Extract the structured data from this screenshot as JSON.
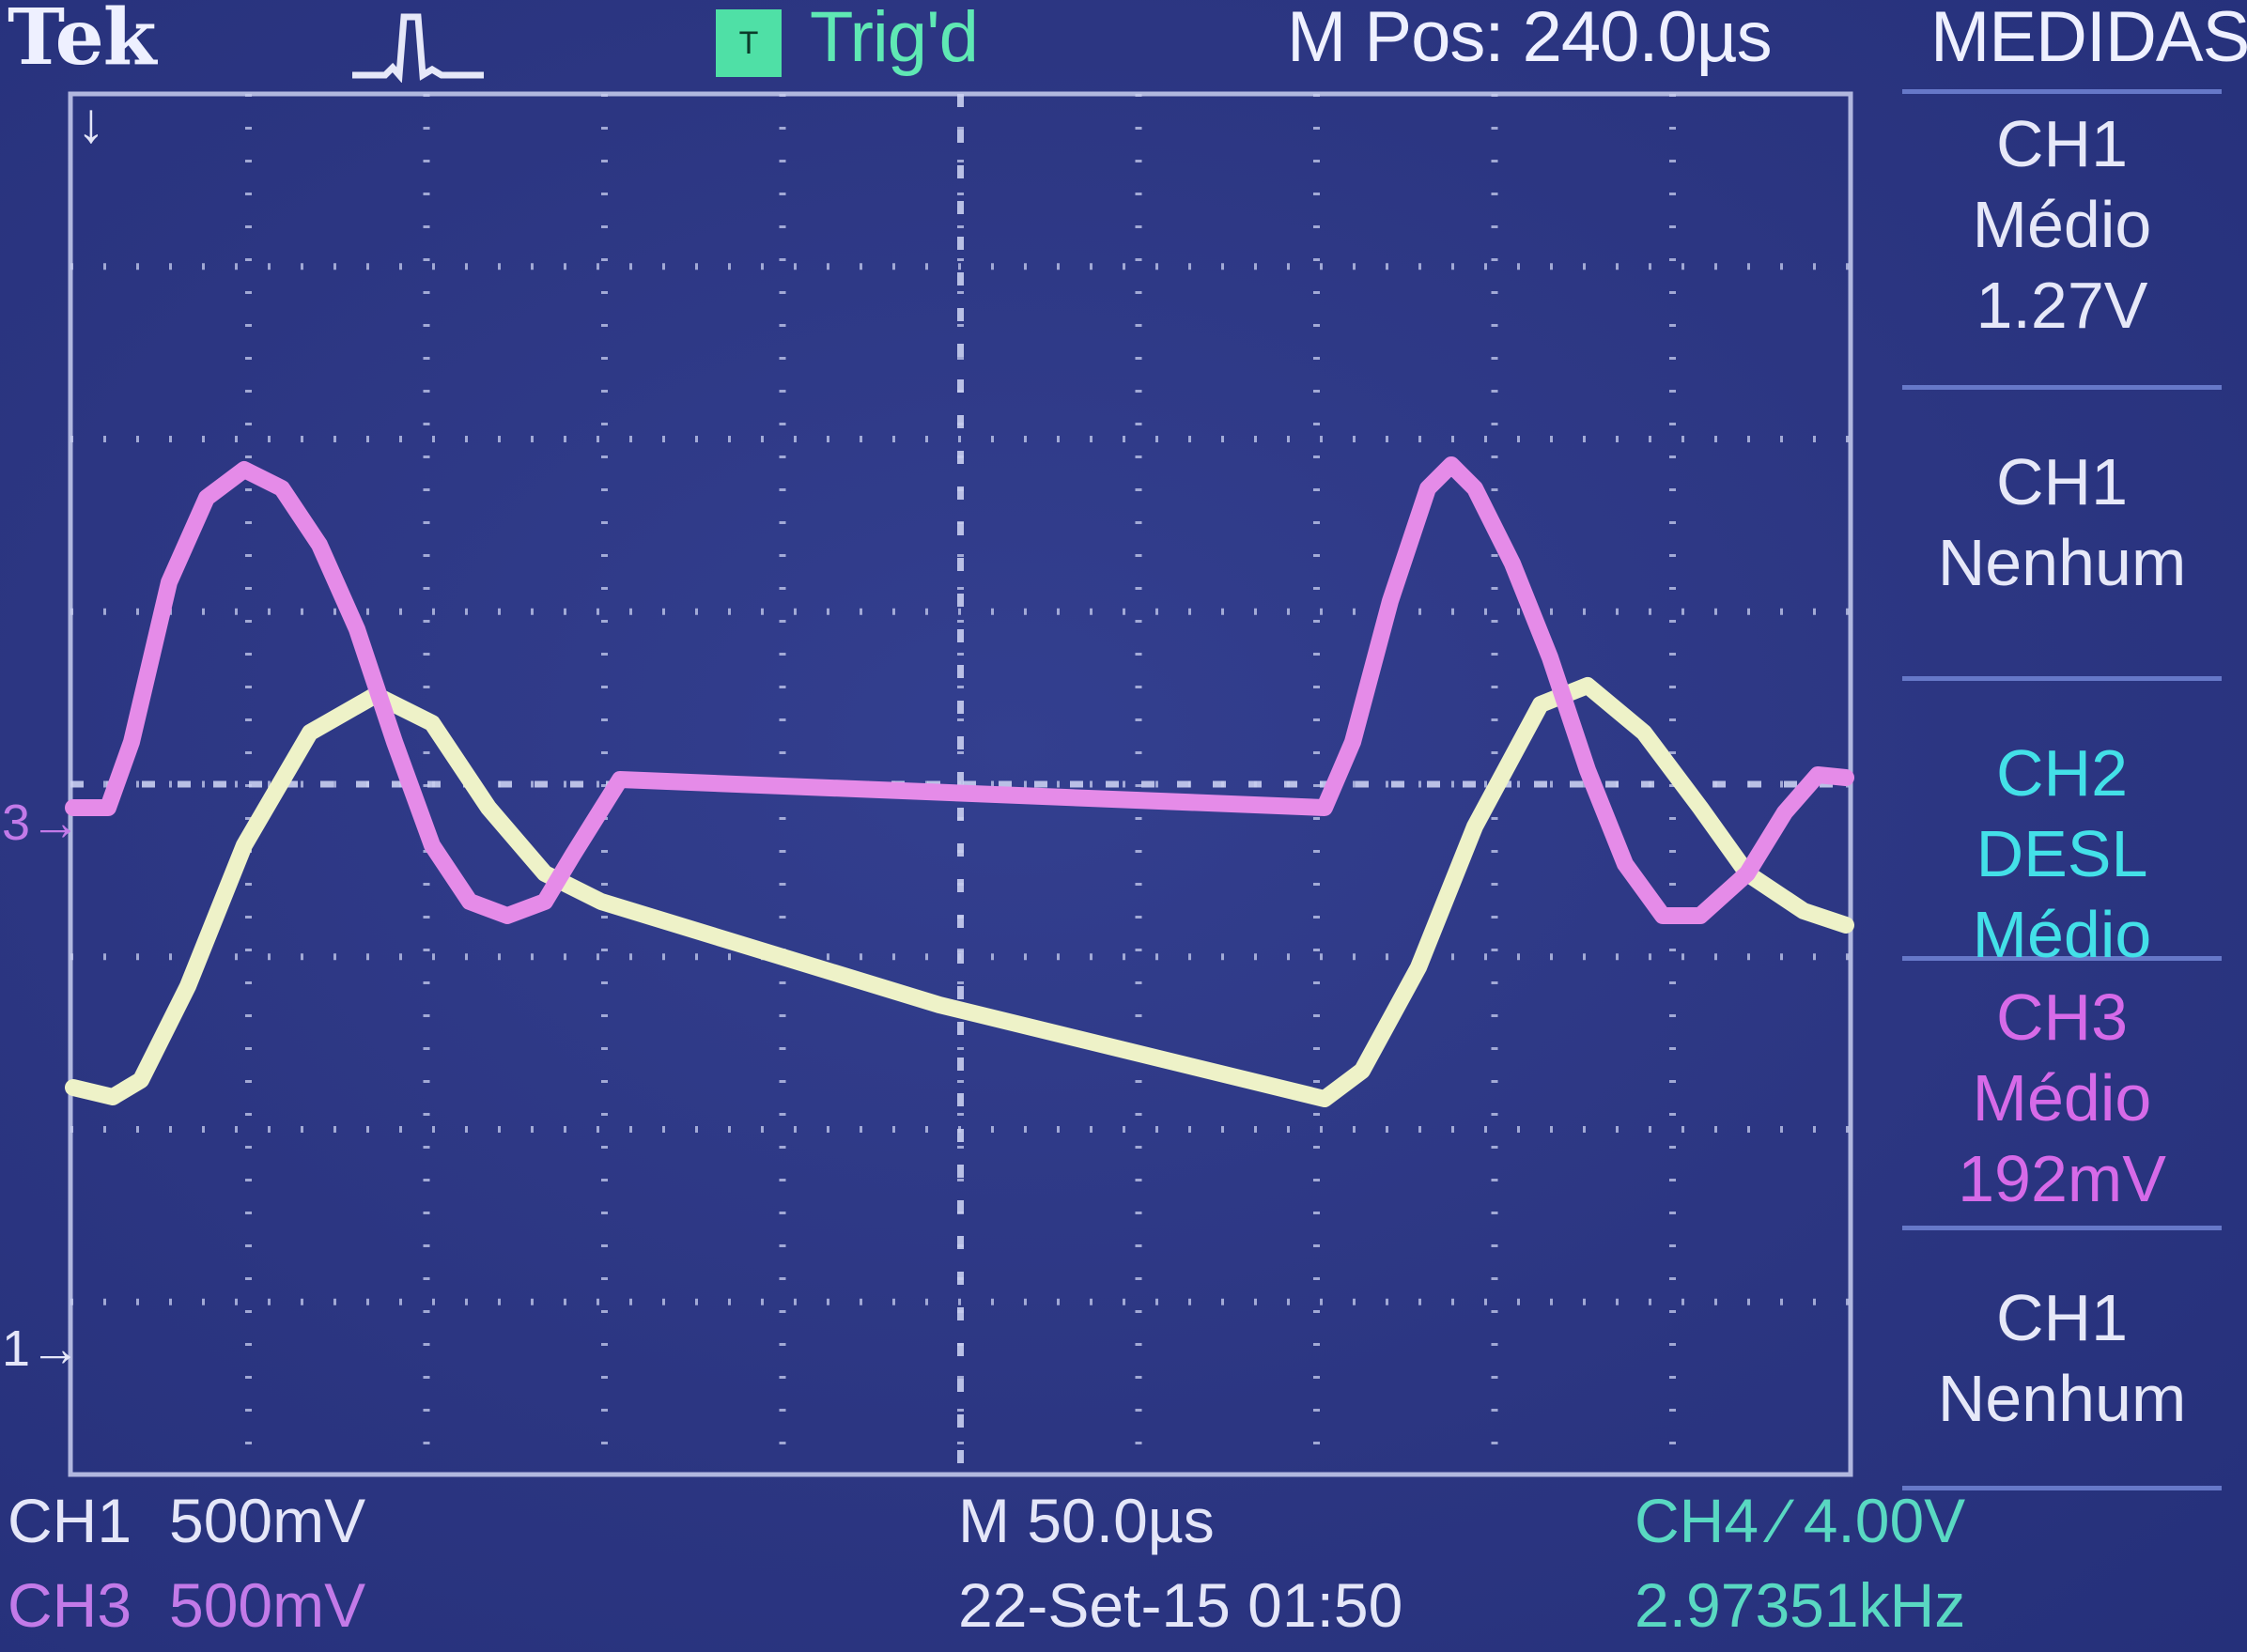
{
  "header": {
    "brand": "Tek",
    "trigger_icon_letter": "T",
    "trigger_status": "Trig'd",
    "m_pos": "M Pos: 240.0µs",
    "menu_title": "MEDIDAS"
  },
  "measurements": [
    {
      "lines": [
        "CH1",
        "Médio",
        "1.27V"
      ],
      "color": "white"
    },
    {
      "lines": [
        "CH1",
        "Nenhum"
      ],
      "color": "white"
    },
    {
      "lines": [
        "CH2 DESL",
        "Médio"
      ],
      "color": "cyan"
    },
    {
      "lines": [
        "CH3",
        "Médio",
        "192mV"
      ],
      "color": "magenta"
    },
    {
      "lines": [
        "CH1",
        "Nenhum"
      ],
      "color": "white"
    }
  ],
  "markers": {
    "ch3": "3",
    "ch1": "1"
  },
  "footer": {
    "ch1_label": "CH1",
    "ch1_scale": "500mV",
    "ch3_label": "CH3",
    "ch3_scale": "500mV",
    "timebase": "M 50.0µs",
    "datetime": "22-Set-15 01:50",
    "trigger": "CH4 ∕ 4.00V",
    "frequency": "2.97351kHz"
  },
  "colors": {
    "background": "#2c3682",
    "grid": "#c9cff0",
    "ch1_trace": "#eef2c8",
    "ch3_trace": "#e58be8",
    "trigger_badge": "#4fe0a6"
  }
}
